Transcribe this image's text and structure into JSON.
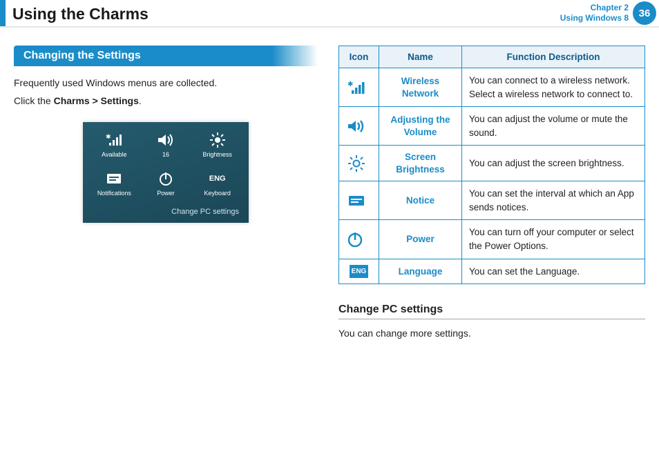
{
  "header": {
    "title": "Using the Charms",
    "chapter_line1": "Chapter 2",
    "chapter_line2": "Using Windows 8",
    "page": "36"
  },
  "section_title": "Changing the Settings",
  "intro_line1": "Frequently used Windows menus are collected.",
  "intro_line2_pre": "Click the ",
  "intro_line2_bold": "Charms > Settings",
  "intro_line2_post": ".",
  "tiles": {
    "available": "Available",
    "volume": "16",
    "brightness": "Brightness",
    "notifications": "Notifications",
    "power": "Power",
    "keyboard": "Keyboard",
    "keyboard_icon": "ENG",
    "change_pc": "Change PC settings"
  },
  "table": {
    "headers": {
      "icon": "Icon",
      "name": "Name",
      "desc": "Function Description"
    },
    "rows": [
      {
        "name": "Wireless Network",
        "desc": "You can connect to a wireless network. Select a wireless network to connect to."
      },
      {
        "name": "Adjusting the Volume",
        "desc": "You can adjust the volume or mute the sound."
      },
      {
        "name": "Screen Brightness",
        "desc": "You can adjust the screen brightness."
      },
      {
        "name": "Notice",
        "desc": "You can set the interval at which an App sends notices."
      },
      {
        "name": "Power",
        "desc": "You can turn off your computer or select the Power Options."
      },
      {
        "name": "Language",
        "desc": "You can set the Language."
      }
    ],
    "lang_icon": "ENG"
  },
  "change_pc_heading": "Change PC settings",
  "change_pc_text": "You can change more settings."
}
